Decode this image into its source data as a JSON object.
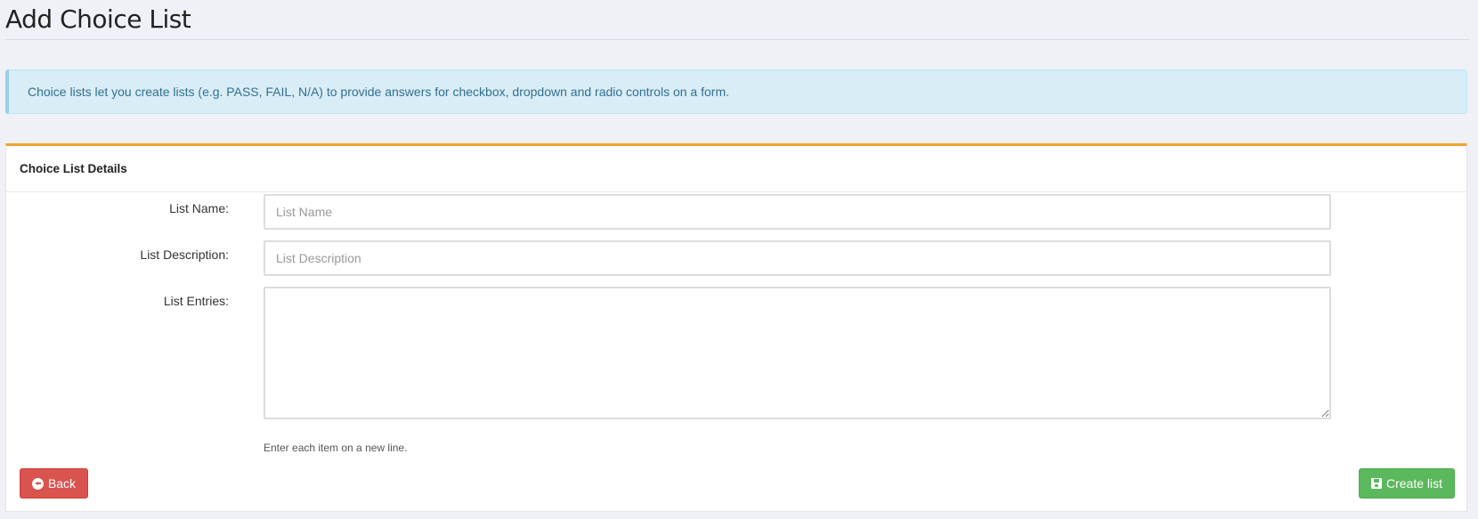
{
  "page": {
    "title": "Add Choice List"
  },
  "alert": {
    "text": "Choice lists let you create lists (e.g. PASS, FAIL, N/A) to provide answers for checkbox, dropdown and radio controls on a form."
  },
  "panel": {
    "heading": "Choice List Details"
  },
  "form": {
    "list_name": {
      "label": "List Name:",
      "placeholder": "List Name",
      "value": ""
    },
    "list_description": {
      "label": "List Description:",
      "placeholder": "List Description",
      "value": ""
    },
    "list_entries": {
      "label": "List Entries:",
      "value": "",
      "help": "Enter each item on a new line."
    }
  },
  "buttons": {
    "back": {
      "label": "Back",
      "icon": "circle-arrow-left-icon",
      "color": "#d9534f"
    },
    "create": {
      "label": "Create list",
      "icon": "floppy-disk-icon",
      "color": "#5cb85c"
    }
  },
  "colors": {
    "panel_accent": "#f0a330",
    "alert_background": "#d9edf7",
    "alert_text": "#31708f"
  }
}
